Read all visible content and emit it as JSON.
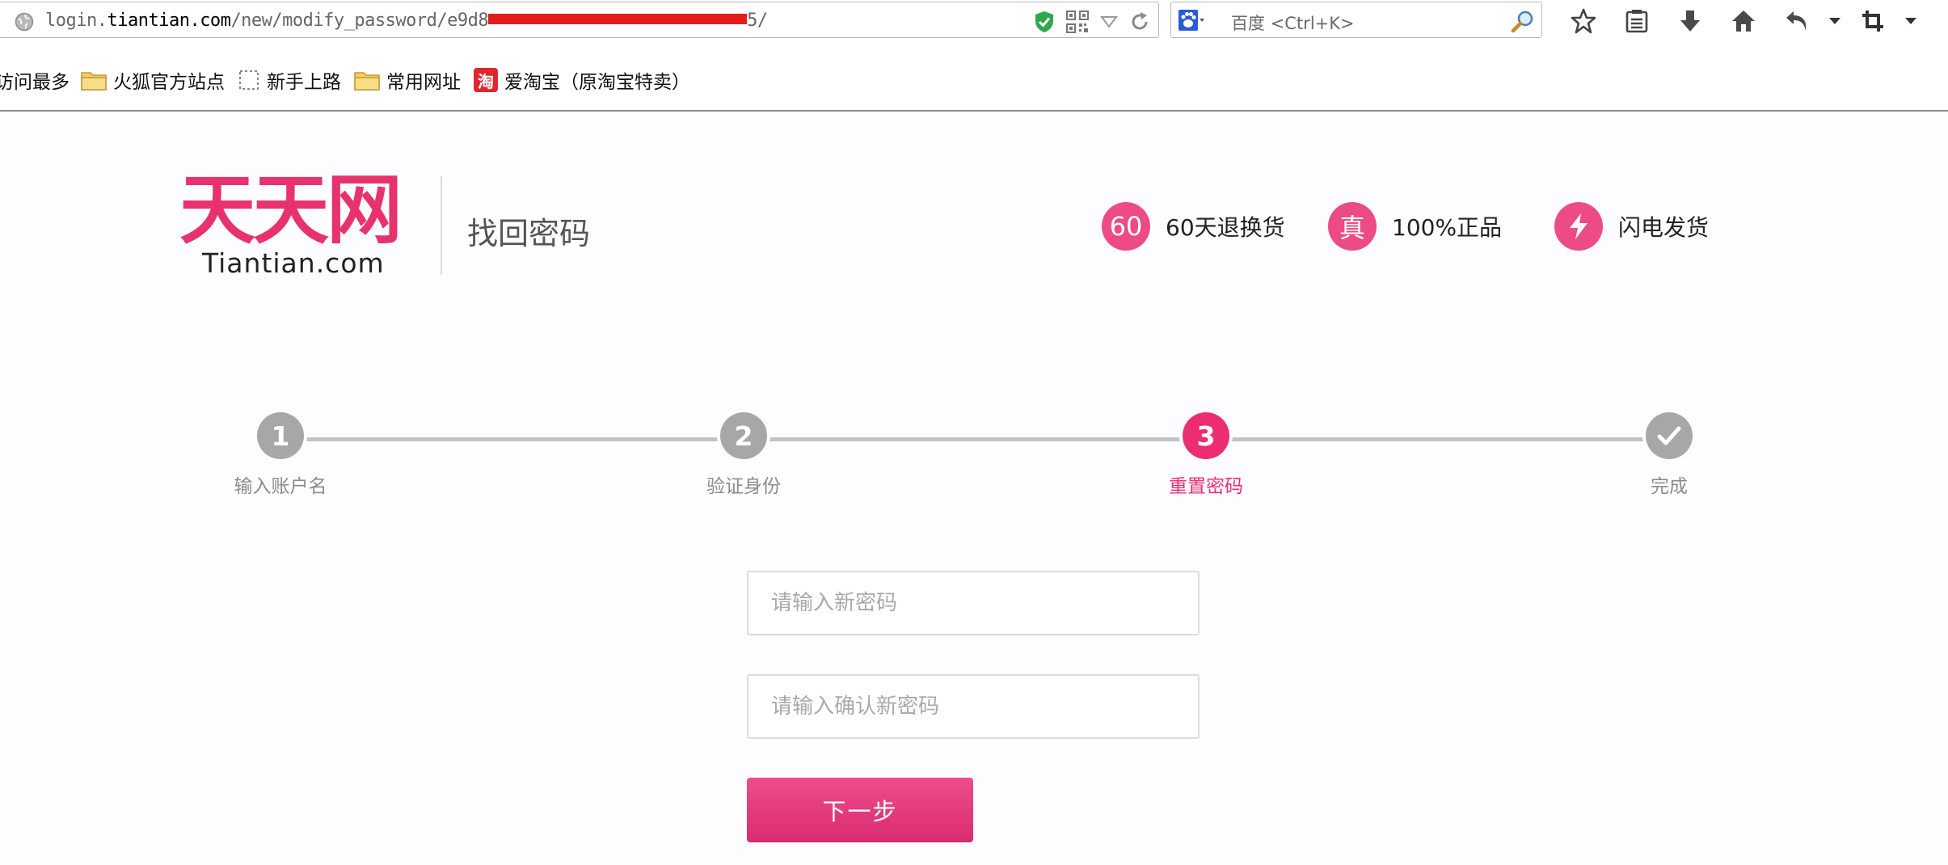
{
  "browser": {
    "url_prefix": "login.",
    "url_host": "tiantian.com",
    "url_path_visible": "/new/modify_password/e9d8",
    "url_suffix": "5/",
    "search_engine": "百度",
    "search_shortcut": "<Ctrl+K>",
    "bookmarks": [
      {
        "label": "访问最多",
        "icon": "none"
      },
      {
        "label": "火狐官方站点",
        "icon": "folder-icon"
      },
      {
        "label": "新手上路",
        "icon": "dashed-page-icon"
      },
      {
        "label": "常用网址",
        "icon": "folder-icon"
      },
      {
        "label": "爱淘宝（原淘宝特卖）",
        "icon": "taobao-icon",
        "badge": "淘"
      }
    ]
  },
  "header": {
    "logo_cn": "天天网",
    "logo_en": "Tiantian.com",
    "page_title": "找回密码",
    "promises": [
      {
        "badge": "60",
        "label": "60天退换货"
      },
      {
        "badge": "真",
        "label": "100%正品"
      },
      {
        "badge": "bolt-icon",
        "label": "闪电发货"
      }
    ]
  },
  "steps": [
    {
      "number": "1",
      "label": "输入账户名",
      "state": "done"
    },
    {
      "number": "2",
      "label": "验证身份",
      "state": "done"
    },
    {
      "number": "3",
      "label": "重置密码",
      "state": "active"
    },
    {
      "number": "check-icon",
      "label": "完成",
      "state": "pending"
    }
  ],
  "form": {
    "new_password_value": "",
    "new_password_placeholder": "请输入新密码",
    "confirm_password_value": "",
    "confirm_password_placeholder": "请输入确认新密码",
    "next_label": "下一步"
  },
  "colors": {
    "brand": "#e8326d",
    "active_step": "#ec2e71",
    "inactive_step": "#a7a7a7",
    "button": "#e03a7d"
  }
}
